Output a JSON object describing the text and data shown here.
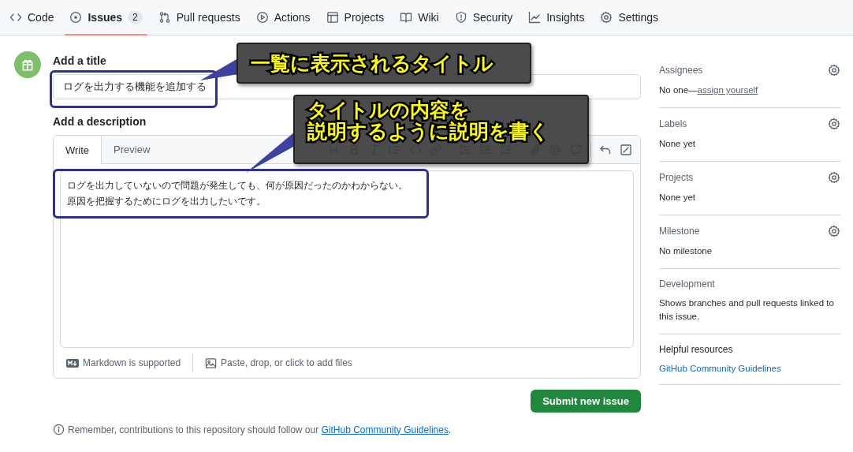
{
  "nav": {
    "tabs": [
      {
        "label": "Code",
        "selected": false
      },
      {
        "label": "Issues",
        "count": "2",
        "selected": true
      },
      {
        "label": "Pull requests",
        "selected": false
      },
      {
        "label": "Actions",
        "selected": false
      },
      {
        "label": "Projects",
        "selected": false
      },
      {
        "label": "Wiki",
        "selected": false
      },
      {
        "label": "Security",
        "selected": false
      },
      {
        "label": "Insights",
        "selected": false
      },
      {
        "label": "Settings",
        "selected": false
      }
    ]
  },
  "form": {
    "title_label": "Add a title",
    "title_value": "ログを出力する機能を追加する",
    "description_label": "Add a description",
    "editor_tabs": [
      {
        "label": "Write",
        "selected": true
      },
      {
        "label": "Preview",
        "selected": false
      }
    ],
    "description_lines": [
      "ログを出力していないので問題が発生しても、何が原因だったのかわからない。",
      "原因を把握するためにログを出力したいです。"
    ],
    "markdown_note": "Markdown is supported",
    "attach_note": "Paste, drop, or click to add files",
    "submit": "Submit new issue",
    "notice": {
      "text": "Remember, contributions to this repository should follow our ",
      "link": "GitHub Community Guidelines",
      "end": "."
    }
  },
  "sidebar": [
    {
      "kind": "setting",
      "heading": "Assignees",
      "text": "No one—",
      "link": "assign yourself"
    },
    {
      "kind": "setting",
      "heading": "Labels",
      "text": "None yet"
    },
    {
      "kind": "setting",
      "heading": "Projects",
      "text": "None yet"
    },
    {
      "kind": "setting",
      "heading": "Milestone",
      "text": "No milestone"
    },
    {
      "kind": "plain",
      "heading": "Development",
      "text": "Shows branches and pull requests linked to this issue."
    },
    {
      "kind": "resource",
      "heading": "Helpful resources",
      "link": "GitHub Community Guidelines"
    }
  ],
  "annotations": [
    {
      "lines": [
        "一覧に表示されるタイトル"
      ]
    },
    {
      "lines": [
        "タイトルの内容を",
        "説明するように説明を書く"
      ]
    }
  ]
}
